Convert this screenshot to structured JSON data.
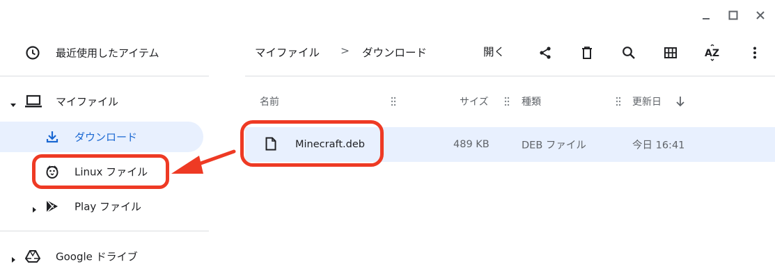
{
  "window": {
    "controls": [
      "minimize-icon",
      "maximize-icon",
      "close-icon"
    ]
  },
  "sidebar": {
    "recent_label": "最近使用したアイテム",
    "my_files_label": "マイファイル",
    "downloads_label": "ダウンロード",
    "linux_files_label": "Linux ファイル",
    "play_files_label": "Play ファイル",
    "google_drive_label": "Google ドライブ"
  },
  "breadcrumb": {
    "root": "マイファイル",
    "separator": ">",
    "current": "ダウンロード"
  },
  "toolbar": {
    "open_label": "開く",
    "icons": [
      "share-icon",
      "delete-icon",
      "search-icon",
      "grid-view-icon",
      "sort-az-icon",
      "more-icon"
    ]
  },
  "columns": {
    "name": "名前",
    "size": "サイズ",
    "type": "種類",
    "modified": "更新日"
  },
  "files": [
    {
      "name": "Minecraft.deb",
      "size": "489 KB",
      "type": "DEB ファイル",
      "modified": "今日 16:41"
    }
  ],
  "colors": {
    "accent": "#1967d2",
    "selection": "#e8f0fe",
    "annotation": "#ee3a24"
  }
}
